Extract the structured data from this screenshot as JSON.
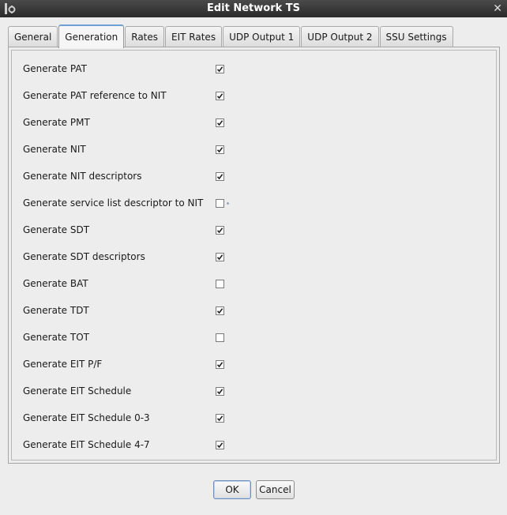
{
  "window": {
    "title": "Edit Network TS",
    "close_glyph": "✕"
  },
  "tabs": [
    {
      "label": "General",
      "active": false
    },
    {
      "label": "Generation",
      "active": true
    },
    {
      "label": "Rates",
      "active": false
    },
    {
      "label": "EIT Rates",
      "active": false
    },
    {
      "label": "UDP Output 1",
      "active": false
    },
    {
      "label": "UDP Output 2",
      "active": false
    },
    {
      "label": "SSU Settings",
      "active": false
    }
  ],
  "options": [
    {
      "label": "Generate PAT",
      "checked": true
    },
    {
      "label": "Generate PAT reference to NIT",
      "checked": true
    },
    {
      "label": "Generate PMT",
      "checked": true
    },
    {
      "label": "Generate NIT",
      "checked": true
    },
    {
      "label": "Generate NIT descriptors",
      "checked": true
    },
    {
      "label": "Generate service list descriptor to NIT",
      "checked": false,
      "focused": true
    },
    {
      "label": "Generate SDT",
      "checked": true
    },
    {
      "label": "Generate SDT descriptors",
      "checked": true
    },
    {
      "label": "Generate BAT",
      "checked": false
    },
    {
      "label": "Generate TDT",
      "checked": true
    },
    {
      "label": "Generate TOT",
      "checked": false
    },
    {
      "label": "Generate EIT P/F",
      "checked": true
    },
    {
      "label": "Generate EIT Schedule",
      "checked": true
    },
    {
      "label": "Generate EIT Schedule 0-3",
      "checked": true
    },
    {
      "label": "Generate EIT Schedule 4-7",
      "checked": true
    }
  ],
  "buttons": {
    "ok": "OK",
    "cancel": "Cancel"
  },
  "colors": {
    "titlebar": "#2b2b2b",
    "active_tab_accent": "#6e9fd4",
    "background": "#ededed"
  }
}
